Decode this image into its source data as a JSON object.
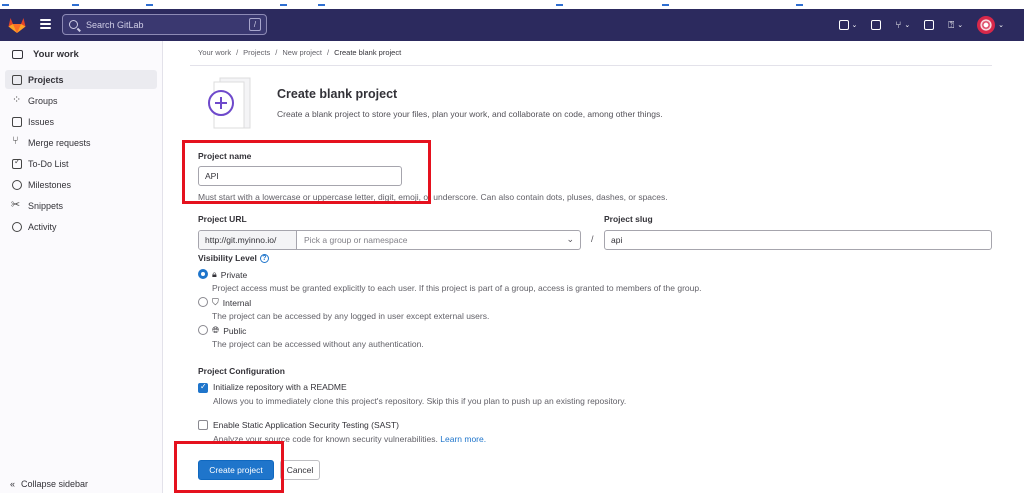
{
  "topbar": {
    "search_placeholder": "Search GitLab",
    "search_shortcut": "/"
  },
  "sidebar": {
    "header": "Your work",
    "items": [
      {
        "label": "Projects",
        "icon": "project-icon",
        "active": true
      },
      {
        "label": "Groups",
        "icon": "group-icon",
        "active": false
      },
      {
        "label": "Issues",
        "icon": "issues-icon",
        "active": false
      },
      {
        "label": "Merge requests",
        "icon": "merge-request-icon",
        "active": false
      },
      {
        "label": "To-Do List",
        "icon": "todo-icon",
        "active": false
      },
      {
        "label": "Milestones",
        "icon": "clock-icon",
        "active": false
      },
      {
        "label": "Snippets",
        "icon": "snippet-icon",
        "active": false
      },
      {
        "label": "Activity",
        "icon": "activity-icon",
        "active": false
      }
    ],
    "collapse_label": "Collapse sidebar"
  },
  "breadcrumb": [
    "Your work",
    "Projects",
    "New project",
    "Create blank project"
  ],
  "header": {
    "title": "Create blank project",
    "subtitle": "Create a blank project to store your files, plan your work, and collaborate on code, among other things."
  },
  "form": {
    "project_name_label": "Project name",
    "project_name_value": "API",
    "project_name_hint": "Must start with a lowercase or uppercase letter, digit, emoji, or underscore. Can also contain dots, pluses, dashes, or spaces.",
    "project_url_label": "Project URL",
    "project_url_prefix": "http://git.myinno.io/",
    "namespace_placeholder": "Pick a group or namespace",
    "url_separator": "/",
    "project_slug_label": "Project slug",
    "project_slug_value": "api",
    "visibility_label": "Visibility Level",
    "visibility_help": "?",
    "visibility_options": [
      {
        "label": "Private",
        "description": "Project access must be granted explicitly to each user. If this project is part of a group, access is granted to members of the group.",
        "checked": true
      },
      {
        "label": "Internal",
        "description": "The project can be accessed by any logged in user except external users.",
        "checked": false
      },
      {
        "label": "Public",
        "description": "The project can be accessed without any authentication.",
        "checked": false
      }
    ],
    "config_label": "Project Configuration",
    "readme_label": "Initialize repository with a README",
    "readme_desc": "Allows you to immediately clone this project's repository. Skip this if you plan to push up an existing repository.",
    "readme_checked": true,
    "sast_label": "Enable Static Application Security Testing (SAST)",
    "sast_desc": "Analyze your source code for known security vulnerabilities.",
    "sast_link": "Learn more.",
    "sast_checked": false,
    "create_button": "Create project",
    "cancel_button": "Cancel"
  },
  "colors": {
    "navbar": "#2c2a5e",
    "primary": "#1f75cb",
    "highlight": "#e5111e"
  }
}
